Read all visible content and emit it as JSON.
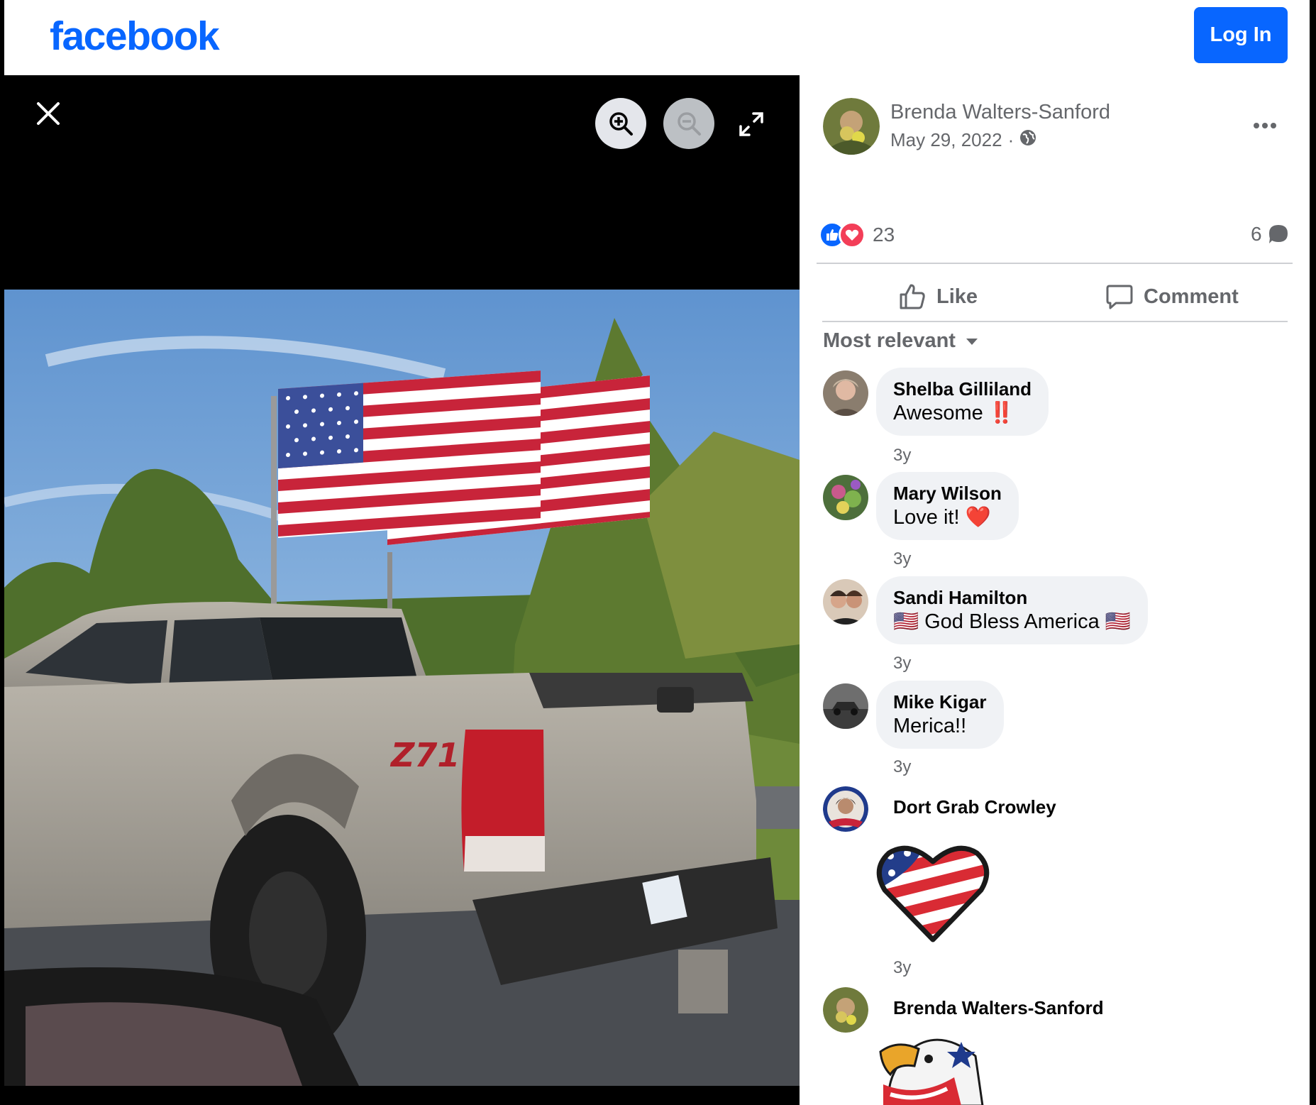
{
  "header": {
    "logo": "facebook",
    "login_label": "Log In"
  },
  "viewer": {
    "close_icon": "close-icon",
    "zoom_in_icon": "zoom-in-icon",
    "zoom_out_icon": "zoom-out-icon",
    "fullscreen_icon": "fullscreen-icon"
  },
  "post": {
    "author": "Brenda Walters-Sanford",
    "date": "May 29, 2022",
    "separator": "·",
    "audience_icon": "globe-icon",
    "reaction_count": "23",
    "comment_count": "6"
  },
  "actions": {
    "like": "Like",
    "comment": "Comment"
  },
  "comments": {
    "sort_label": "Most relevant",
    "items": [
      {
        "name": "Shelba Gilliland",
        "text": "Awesome",
        "emoji": "‼️",
        "time": "3y"
      },
      {
        "name": "Mary Wilson",
        "text": "Love it!",
        "emoji": "❤️",
        "time": "3y"
      },
      {
        "name": "Sandi Hamilton",
        "text": "God Bless America",
        "emoji": "🇺🇸",
        "time": "3y"
      },
      {
        "name": "Mike Kigar",
        "text": "Merica!!",
        "time": "3y"
      },
      {
        "name": "Dort Grab Crowley",
        "sticker": "flag-heart-sticker",
        "time": "3y"
      },
      {
        "name": "Brenda Walters-Sanford",
        "sticker": "eagle-sticker"
      }
    ]
  },
  "colors": {
    "brand_blue": "#0866ff",
    "secondary_text": "#65676b",
    "bubble_bg": "#f0f2f5",
    "love_red": "#f33e58"
  }
}
